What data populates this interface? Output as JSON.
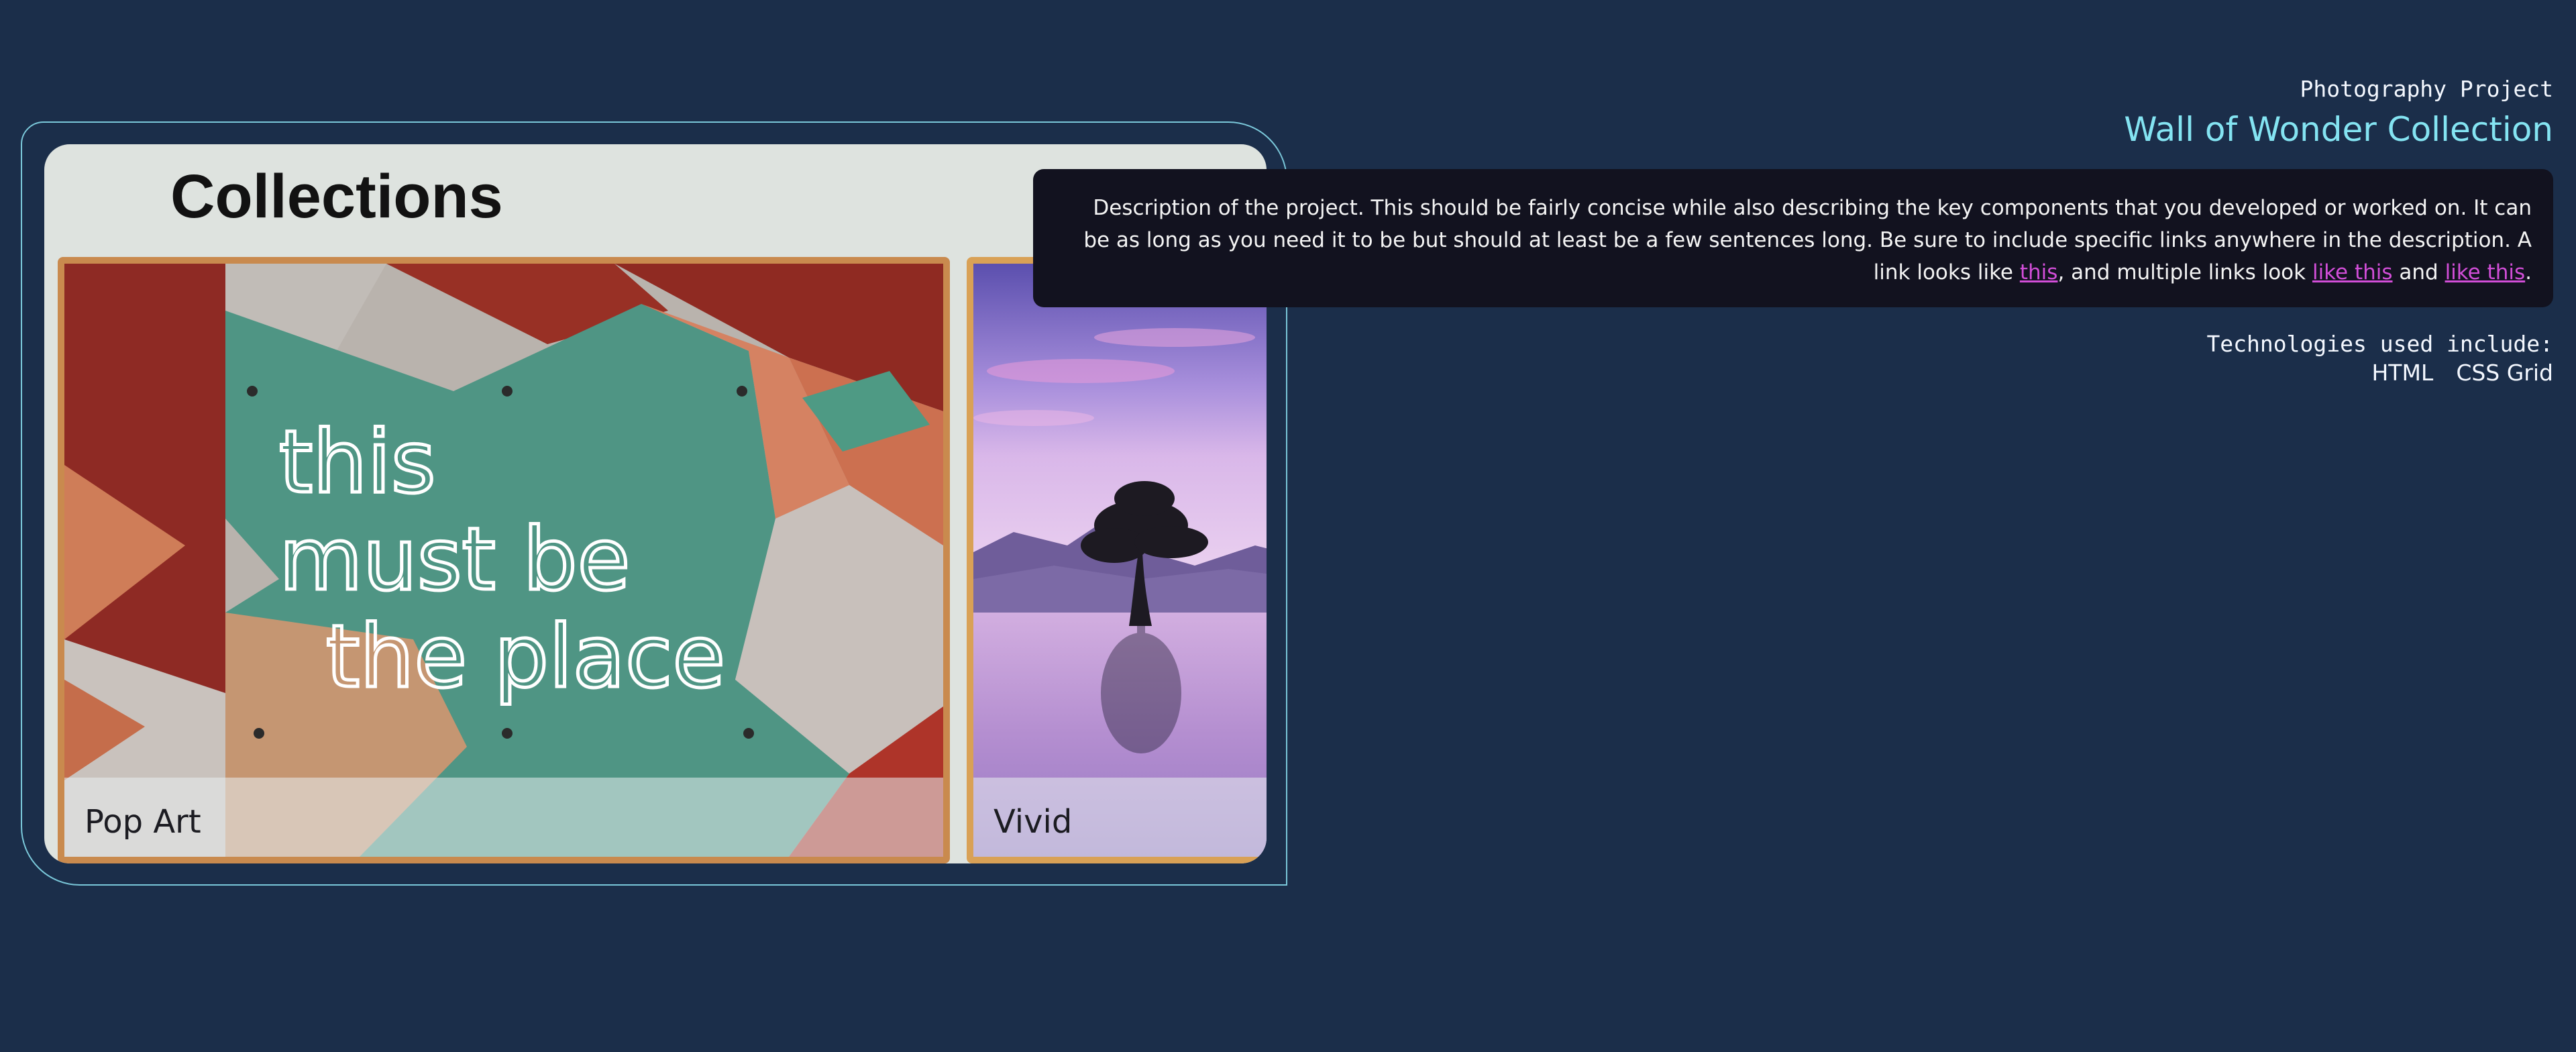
{
  "project": {
    "kicker": "Photography Project",
    "title": "Wall of Wonder Collection",
    "description": {
      "text_1": "Description of the project. This should be fairly concise while also describing the key components that you developed or worked on. It can be as long as you need it to be but should at least be a few sentences long. Be sure to include specific links anywhere in the description. A link looks like ",
      "link_1": "this",
      "text_2": ", and multiple links look ",
      "link_2": "like this",
      "text_3": " and ",
      "link_3": "like this",
      "text_4": "."
    },
    "technologies_label": "Technologies used include:",
    "technologies": [
      "HTML",
      "CSS Grid"
    ]
  },
  "screenshot": {
    "heading": "Collections",
    "cards": [
      {
        "label": "Pop Art",
        "image": "neon-sign-photo",
        "neon_lines": [
          "this",
          "must be",
          "the place"
        ]
      },
      {
        "label": "Vivid",
        "image": "lake-tree-photo"
      }
    ]
  },
  "colors": {
    "background": "#1b2e4a",
    "accent": "#84e4f2",
    "frame_border": "#7ac7d9",
    "description_background": "#12121f",
    "link": "#d24ed8"
  }
}
